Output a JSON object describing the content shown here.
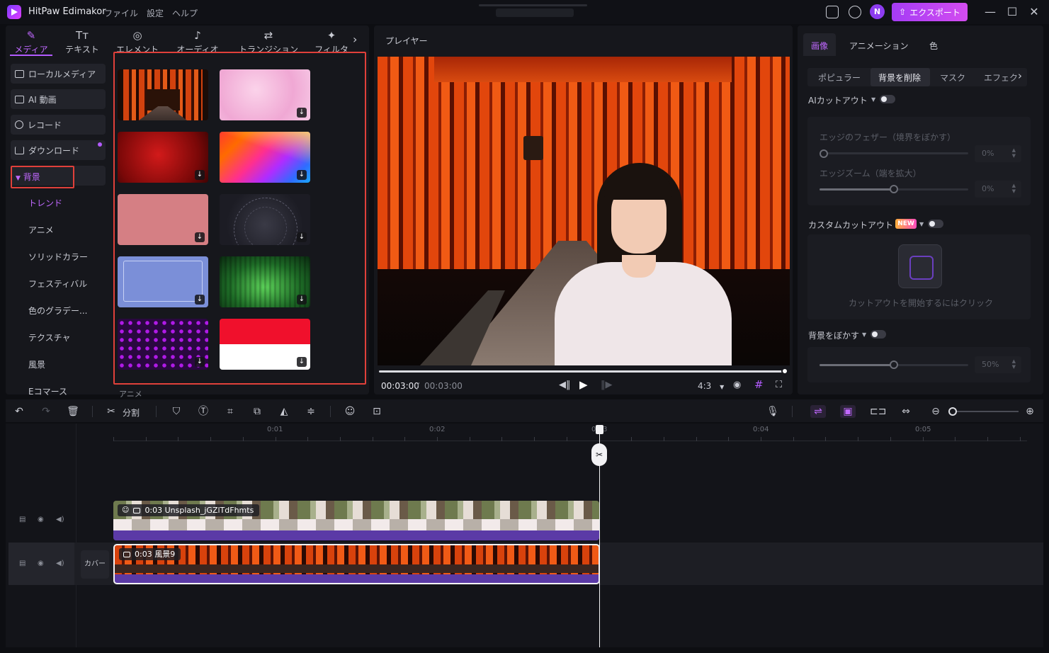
{
  "app": {
    "title": "HitPaw Edimakor",
    "menu": [
      "ファイル",
      "設定",
      "ヘルプ"
    ],
    "avatar_initial": "N",
    "export_label": "エクスポート"
  },
  "left_tabs": [
    {
      "label": "メディア",
      "icon": "media-icon",
      "active": true
    },
    {
      "label": "テキスト",
      "icon": "text-icon"
    },
    {
      "label": "エレメント",
      "icon": "elements-icon"
    },
    {
      "label": "オーディオ",
      "icon": "audio-icon"
    },
    {
      "label": "トランジション",
      "icon": "transition-icon"
    },
    {
      "label": "フィルタ",
      "icon": "filter-icon"
    }
  ],
  "categories": [
    {
      "label": "ローカルメディア",
      "icon": "folder-icon"
    },
    {
      "label": "AI 動画",
      "icon": "ai-video-icon"
    },
    {
      "label": "レコード",
      "icon": "record-icon"
    },
    {
      "label": "ダウンロード",
      "icon": "download-icon"
    }
  ],
  "background": {
    "label": "背景",
    "subitems": [
      "トレンド",
      "アニメ",
      "ソリッドカラー",
      "フェスティバル",
      "色のグラデー...",
      "テクスチャ",
      "風景",
      "Eコマース"
    ],
    "active_subitem": "トレンド",
    "more_label": "アニメ"
  },
  "player": {
    "label": "プレイヤー",
    "time_current": "00:03:00",
    "time_separator": " / ",
    "time_total": "00:03:00",
    "progress": 1.0,
    "ratio": "4:3"
  },
  "right_panel": {
    "tabs": [
      "画像",
      "アニメーション",
      "色"
    ],
    "active_tab": "画像",
    "subtabs": [
      "ポピュラー",
      "背景を削除",
      "マスク",
      "エフェク"
    ],
    "active_subtab": "背景を削除",
    "ai_cutout_label": "AIカットアウト",
    "edge_feather_label": "エッジのフェザー（境界をぼかす）",
    "edge_feather_value": "0%",
    "edge_feather_level": 0.0,
    "edge_zoom_label": "エッジズーム（端を拡大）",
    "edge_zoom_value": "0%",
    "edge_zoom_level": 0.5,
    "custom_cutout_label": "カスタムカットアウト",
    "new_badge": "NEW",
    "cutout_hint": "カットアウトを開始するにはクリック",
    "blur_bg_label": "背景をぼかす",
    "blur_value": "50%",
    "blur_level": 0.5
  },
  "toolbar": {
    "split_label": "分割"
  },
  "timeline": {
    "ruler": [
      "0:01",
      "0:02",
      "0:03",
      "0:04",
      "0:05"
    ],
    "clips": [
      {
        "label": "0:03 Unsplash_jGZlTdFhmts"
      },
      {
        "label": "0:03 風景9"
      }
    ],
    "cover_label": "カバー"
  }
}
